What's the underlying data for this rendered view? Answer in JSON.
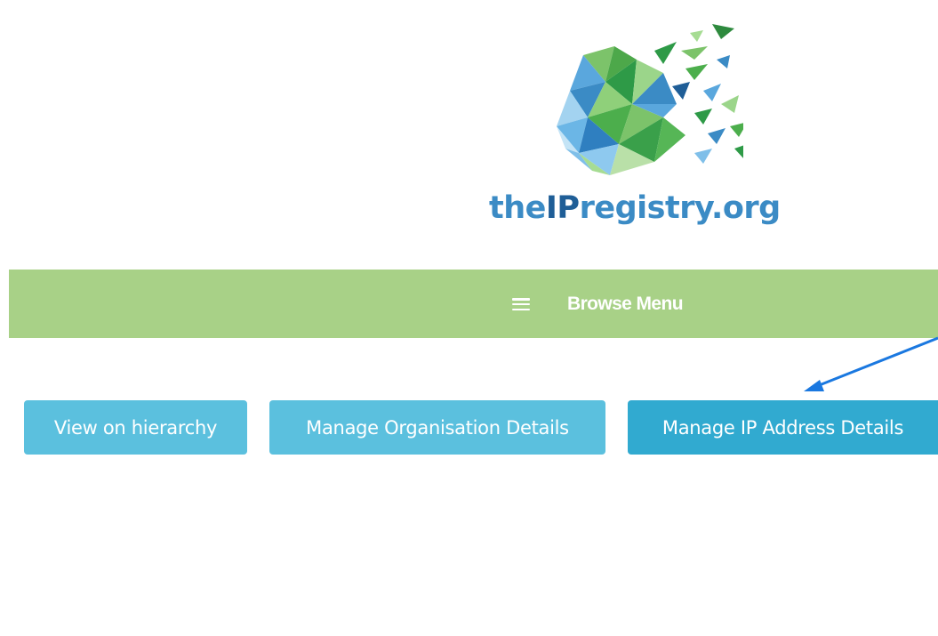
{
  "logo": {
    "text_prefix": "the",
    "text_strong": "IP",
    "text_suffix": "registry.org",
    "icon": "polygon-globe-icon",
    "colors": {
      "text_light": "#3b8bc5",
      "text_dark": "#1f5e97",
      "green": "#4cae4c",
      "blue": "#3b8bc5"
    }
  },
  "browse_menu": {
    "label": "Browse Menu",
    "icon": "hamburger-icon",
    "background": "#a8d187"
  },
  "actions": {
    "view_hierarchy": "View on hierarchy",
    "manage_org": "Manage Organisation Details",
    "manage_ip": "Manage IP Address Details"
  },
  "colors": {
    "button": "#5bc0de",
    "button_active": "#31aad0",
    "annotation_arrow": "#1a78e0"
  }
}
